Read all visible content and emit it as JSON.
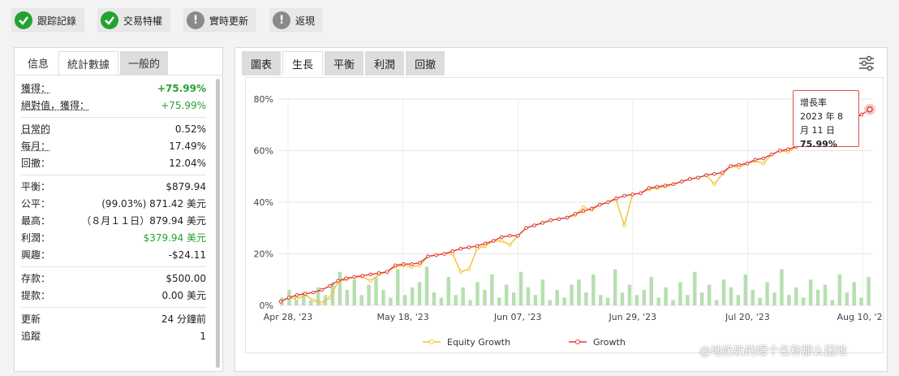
{
  "badges": [
    {
      "label": "跟踪記錄",
      "status": "ok"
    },
    {
      "label": "交易特權",
      "status": "ok"
    },
    {
      "label": "實時更新",
      "status": "wait"
    },
    {
      "label": "返現",
      "status": "wait"
    }
  ],
  "left_tabs": [
    "信息",
    "統計數據",
    "一般的"
  ],
  "stats": {
    "g1": [
      {
        "k": "獲得：",
        "v": "+75.99%"
      },
      {
        "k": "絕對值，獲得：",
        "v": "+75.99%"
      }
    ],
    "g2": [
      {
        "k": "日常的",
        "v": "0.52%"
      },
      {
        "k": "每月：",
        "v": "17.49%"
      },
      {
        "k": "回撤：",
        "v": "12.04%"
      }
    ],
    "g3": [
      {
        "k": "平衡：",
        "v": "$879.94"
      },
      {
        "k": "公平：",
        "v": "(99.03%) 871.42 美元"
      },
      {
        "k": "最高：",
        "v": "（８月１１日）879.94 美元"
      },
      {
        "k": "利潤：",
        "v": "$379.94 美元"
      },
      {
        "k": "興趣：",
        "v": "-$24.11"
      }
    ],
    "g4": [
      {
        "k": "存款：",
        "v": "$500.00"
      },
      {
        "k": "提款：",
        "v": "0.00 美元"
      }
    ],
    "g5": [
      {
        "k": "更新",
        "v": "24 分鐘前"
      },
      {
        "k": "追蹤",
        "v": "1"
      }
    ]
  },
  "right_tabs": [
    "圖表",
    "生長",
    "平衡",
    "利潤",
    "回撤"
  ],
  "tooltip": {
    "title": "增長率",
    "date": "2023 年 8 月 11 日",
    "value": "75.99%"
  },
  "watermark": "@地奶奶的爆个名称那么困难",
  "colors": {
    "equity": "#f2c12e",
    "growth": "#e03a3a",
    "bars": "#b6dfb0",
    "green": "#23a234"
  },
  "chart_data": {
    "type": "line",
    "x_ticks": [
      "Apr 28, '23",
      "May 18, '23",
      "Jun 07, '23",
      "Jun 29, '23",
      "Jul 20, '23",
      "Aug 10, '23"
    ],
    "y_ticks": [
      "0%",
      "20%",
      "40%",
      "60%",
      "80%"
    ],
    "ylim": [
      0,
      80
    ],
    "legend": [
      "Equity Growth",
      "Growth"
    ],
    "series": [
      {
        "name": "Growth",
        "values": [
          1.5,
          3,
          4,
          4.5,
          5,
          6,
          7.5,
          9.5,
          10.5,
          11,
          11.5,
          12,
          12.5,
          13,
          15.5,
          16,
          16,
          16.5,
          19,
          19.5,
          20,
          21,
          22,
          22.5,
          23,
          24,
          25,
          26.5,
          27,
          27,
          30,
          31,
          32,
          33,
          33.5,
          34,
          35.5,
          36.5,
          37.5,
          39,
          40,
          41.5,
          42.5,
          43,
          43.5,
          45.5,
          46,
          46.5,
          47,
          48,
          49,
          49.5,
          50.5,
          51,
          51.5,
          54,
          54.5,
          55,
          56.5,
          57,
          58.5,
          60,
          60.5,
          61.5,
          64,
          65,
          66,
          68,
          70,
          71,
          72.5,
          74,
          76
        ]
      },
      {
        "name": "Equity Growth",
        "values": [
          1.5,
          3,
          2.5,
          4,
          2,
          1,
          3,
          9,
          10,
          11,
          11,
          9.5,
          12,
          13,
          15,
          15.5,
          15,
          15.5,
          19,
          19.5,
          20,
          20,
          13,
          14,
          22,
          23,
          25,
          25,
          23.5,
          27,
          30,
          31,
          32,
          33,
          33.5,
          34,
          35,
          38,
          37,
          39,
          40,
          41,
          31,
          43,
          43.5,
          45,
          45.5,
          46,
          47,
          48,
          49,
          49.5,
          50.5,
          47,
          51,
          54,
          53.5,
          55,
          56,
          55,
          58.5,
          60,
          59.5,
          61.5,
          64,
          65,
          66,
          68,
          70,
          71,
          72,
          74,
          76
        ]
      }
    ],
    "bars": [
      3,
      6,
      4,
      5,
      2,
      7,
      4,
      9,
      13,
      6,
      10,
      4,
      8,
      11,
      6,
      3,
      14,
      4,
      7,
      9,
      15,
      5,
      3,
      11,
      4,
      7,
      2,
      9,
      6,
      12,
      3,
      8,
      5,
      13,
      7,
      4,
      10,
      2,
      6,
      3,
      8,
      10,
      5,
      12,
      4,
      3,
      14,
      5,
      8,
      4,
      6,
      11,
      3,
      7,
      2,
      9,
      4,
      13,
      5,
      8,
      2,
      10,
      7,
      4,
      12,
      6,
      3,
      9,
      5,
      14,
      4,
      7,
      3,
      10,
      6,
      8,
      2,
      12,
      5,
      9,
      3,
      11
    ]
  }
}
